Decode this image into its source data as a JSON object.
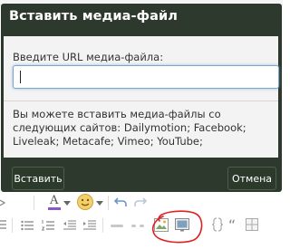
{
  "dialog": {
    "title": "Вставить медиа-файл",
    "url_label": "Введите URL медиа-файла:",
    "url_value": "",
    "info_text": "Вы можете вставить медиа-файлы со следующих сайтов: Dailymotion; Facebook; Liveleak; Metacafe; Vimeo; YouTube;",
    "insert_button": "Вставить",
    "cancel_button": "Отмена"
  },
  "toolbar": {
    "font_color_letter": "A",
    "quote_mark": "“",
    "row1_icons": [
      "indent-icon",
      "font-color-icon",
      "dropdown-icon",
      "smiley-icon",
      "dropdown-icon",
      "undo-icon",
      "redo-icon"
    ],
    "row2_icons": [
      "align-icon",
      "bullet-list-icon",
      "numbered-list-icon",
      "outdent-icon",
      "indent-icon",
      "link-icon",
      "unlink-icon",
      "image-icon",
      "media-icon",
      "code-icon",
      "quote-icon",
      "table-icon"
    ]
  },
  "colors": {
    "dialog_dark": "#2d392d",
    "accent_annotation": "#e02020",
    "input_focus": "#7aa6cf"
  }
}
